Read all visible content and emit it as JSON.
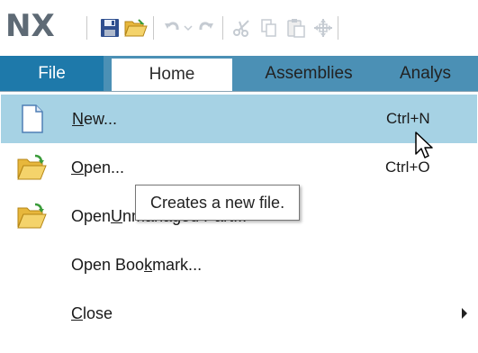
{
  "app": {
    "logo_text": "NX"
  },
  "toolbar": {
    "buttons": [
      {
        "icon": "save-icon"
      },
      {
        "icon": "open-folder-icon"
      },
      {
        "icon": "undo-icon"
      },
      {
        "icon": "dropdown-arrow-icon"
      },
      {
        "icon": "redo-icon"
      },
      {
        "icon": "cut-icon"
      },
      {
        "icon": "copy-icon"
      },
      {
        "icon": "paste-icon"
      },
      {
        "icon": "move-icon"
      }
    ]
  },
  "ribbon": {
    "tabs": [
      {
        "label": "File",
        "active": false,
        "highlighted": true
      },
      {
        "label": "Home",
        "active": true
      },
      {
        "label": "Assemblies",
        "active": false
      },
      {
        "label": "Analys",
        "active": false
      }
    ]
  },
  "file_menu": {
    "items": [
      {
        "label_accel": "N",
        "label_rest": "ew...",
        "shortcut": "Ctrl+N",
        "icon": "new-file-icon",
        "highlighted": true
      },
      {
        "label_accel": "O",
        "label_rest": "pen...",
        "shortcut": "Ctrl+O",
        "icon": "open-folder-icon"
      },
      {
        "label_pre": "Open ",
        "label_accel": "U",
        "label_rest": "nmanaged Part...",
        "icon": "open-folder-icon"
      },
      {
        "label_pre": "Open Boo",
        "label_accel": "k",
        "label_rest": "mark..."
      },
      {
        "label_accel": "C",
        "label_rest": "lose",
        "has_submenu": true
      }
    ]
  },
  "tooltip": {
    "text": "Creates a new file."
  },
  "colors": {
    "tab_bar": "#4b90b5",
    "file_tab": "#1e79aa",
    "menu_highlight": "#a6d2e4",
    "logo": "#5e6a75"
  }
}
